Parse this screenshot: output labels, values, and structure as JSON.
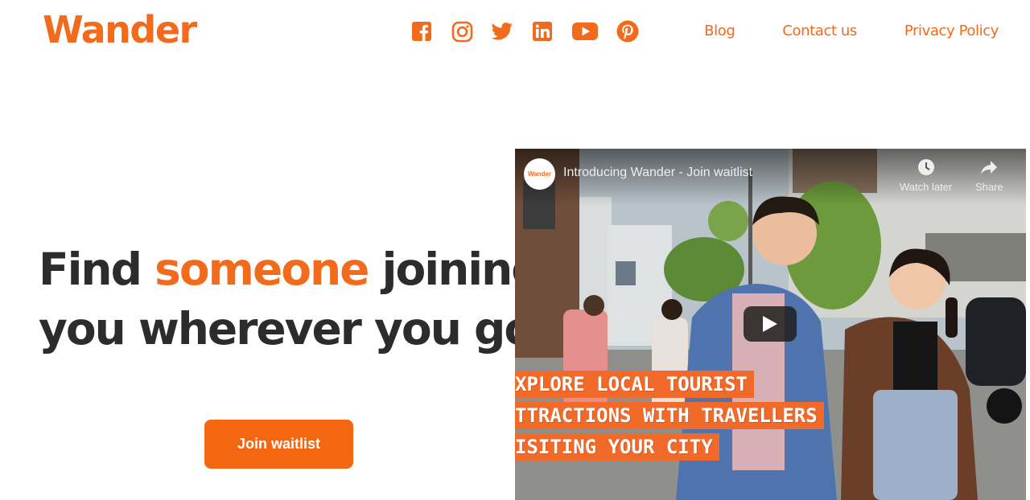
{
  "brand": {
    "logo": "Wander",
    "accent": "#f26a1b",
    "text_dark": "#2c2c2c"
  },
  "socials": [
    {
      "name": "facebook-icon"
    },
    {
      "name": "instagram-icon"
    },
    {
      "name": "twitter-icon"
    },
    {
      "name": "linkedin-icon"
    },
    {
      "name": "youtube-icon"
    },
    {
      "name": "pinterest-icon"
    }
  ],
  "nav": {
    "blog": "Blog",
    "contact": "Contact us",
    "privacy": "Privacy Policy"
  },
  "hero": {
    "part1": "Find ",
    "accent": "someone",
    "part2": " joining",
    "line2": "you wherever you go.",
    "cta": "Join waitlist"
  },
  "video": {
    "channel": "Wander",
    "title": "Introducing Wander - Join waitlist",
    "watch_later": "Watch later",
    "share": "Share",
    "captions": [
      "XPLORE LOCAL TOURIST",
      "TTRACTIONS WITH TRAVELLERS",
      "ISITING YOUR CITY"
    ]
  }
}
